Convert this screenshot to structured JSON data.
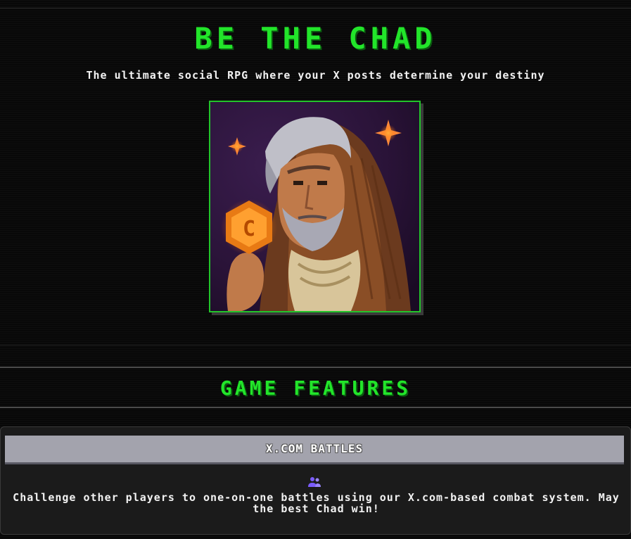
{
  "hero": {
    "title": "BE THE CHAD",
    "subtitle": "The ultimate social RPG where your X posts determine your destiny",
    "accent_color": "#22e52a"
  },
  "portrait": {
    "description_icon": "hooded-wizard-portrait",
    "coin_letter": "C"
  },
  "features": {
    "title": "GAME FEATURES",
    "cards": [
      {
        "title": "X.COM BATTLES",
        "icon": "users-icon",
        "description": "Challenge other players to one-on-one battles using our X.com-based combat system. May the best Chad win!"
      }
    ]
  }
}
